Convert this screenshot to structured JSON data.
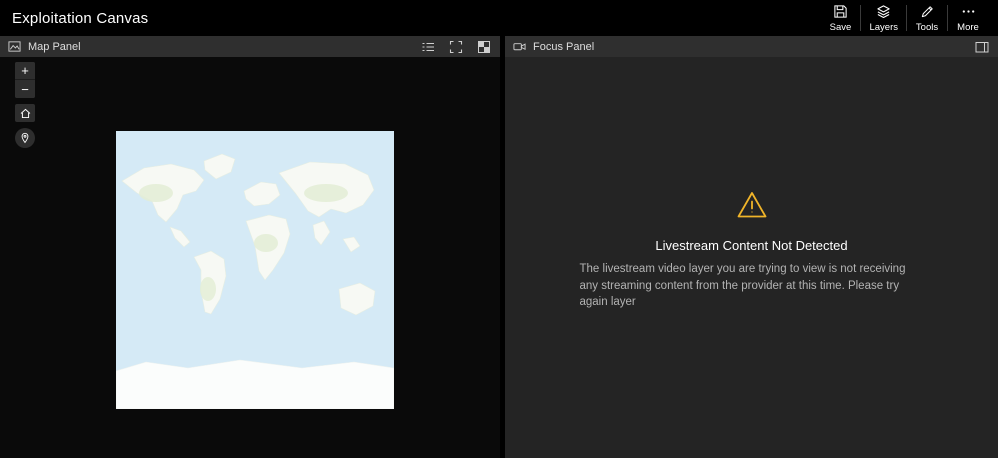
{
  "app": {
    "title": "Exploitation Canvas"
  },
  "topbar": {
    "actions": [
      {
        "label": "Save",
        "icon": "save-icon"
      },
      {
        "label": "Layers",
        "icon": "layers-icon"
      },
      {
        "label": "Tools",
        "icon": "tools-icon"
      },
      {
        "label": "More",
        "icon": "more-icon"
      }
    ]
  },
  "map_panel": {
    "title": "Map Panel",
    "header_icon": "map-icon",
    "header_tools": [
      {
        "icon": "legend-list-icon"
      },
      {
        "icon": "expand-icon"
      },
      {
        "icon": "basemap-grid-icon"
      }
    ],
    "toolbar": {
      "zoom_in_label": "+",
      "zoom_out_label": "−",
      "home_icon": "home-icon",
      "locate_icon": "location-pin-icon"
    }
  },
  "focus_panel": {
    "title": "Focus Panel",
    "header_icon": "video-camera-icon",
    "header_tool_icon": "panel-toggle-icon",
    "alert": {
      "icon": "warning-triangle-icon",
      "heading": "Livestream Content Not Detected",
      "body": "The livestream video layer you are trying to view is not receiving any streaming content from the provider at this time. Please try again layer"
    }
  },
  "colors": {
    "warning": "#f0b429",
    "topbar_bg": "#000000",
    "panel_header_bg": "#2f2f2f",
    "map_bg": "#0a0a0a",
    "focus_bg": "#242424",
    "ocean": "#d5eaf6"
  }
}
